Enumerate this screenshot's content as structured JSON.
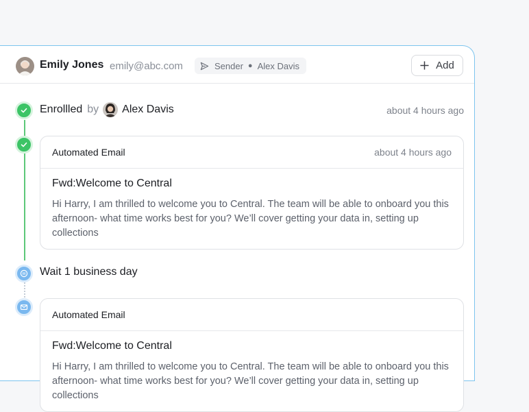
{
  "header": {
    "name": "Emily Jones",
    "email": "emily@abc.com",
    "sender_label": "Sender",
    "sender_name": "Alex Davis",
    "add_label": "Add"
  },
  "timeline": {
    "enrolled": {
      "title": "Enrollled",
      "by": "by",
      "actor": "Alex Davis",
      "time": "about 4 hours ago"
    },
    "email1": {
      "type": "Automated Email",
      "time": "about 4 hours ago",
      "subject": "Fwd:Welcome to Central",
      "body": "Hi Harry, I am thrilled to welcome you to Central. The team will be able to onboard you this afternoon- what time works best for you? We’ll cover getting your data in, setting up collections"
    },
    "wait": {
      "title": "Wait 1 business day"
    },
    "email2": {
      "type": "Automated Email",
      "subject": "Fwd:Welcome to Central",
      "body": "Hi Harry, I am thrilled to welcome you to Central. The team will be able to onboard you this afternoon- what time works best for you? We’ll cover getting your data in, setting up collections"
    }
  },
  "colors": {
    "accent_border": "#7cc4ee",
    "success": "#3cc466",
    "pending": "#7ab8ef"
  },
  "icons": [
    "send-icon",
    "plus-icon",
    "check-icon",
    "pause-icon",
    "mail-icon"
  ]
}
